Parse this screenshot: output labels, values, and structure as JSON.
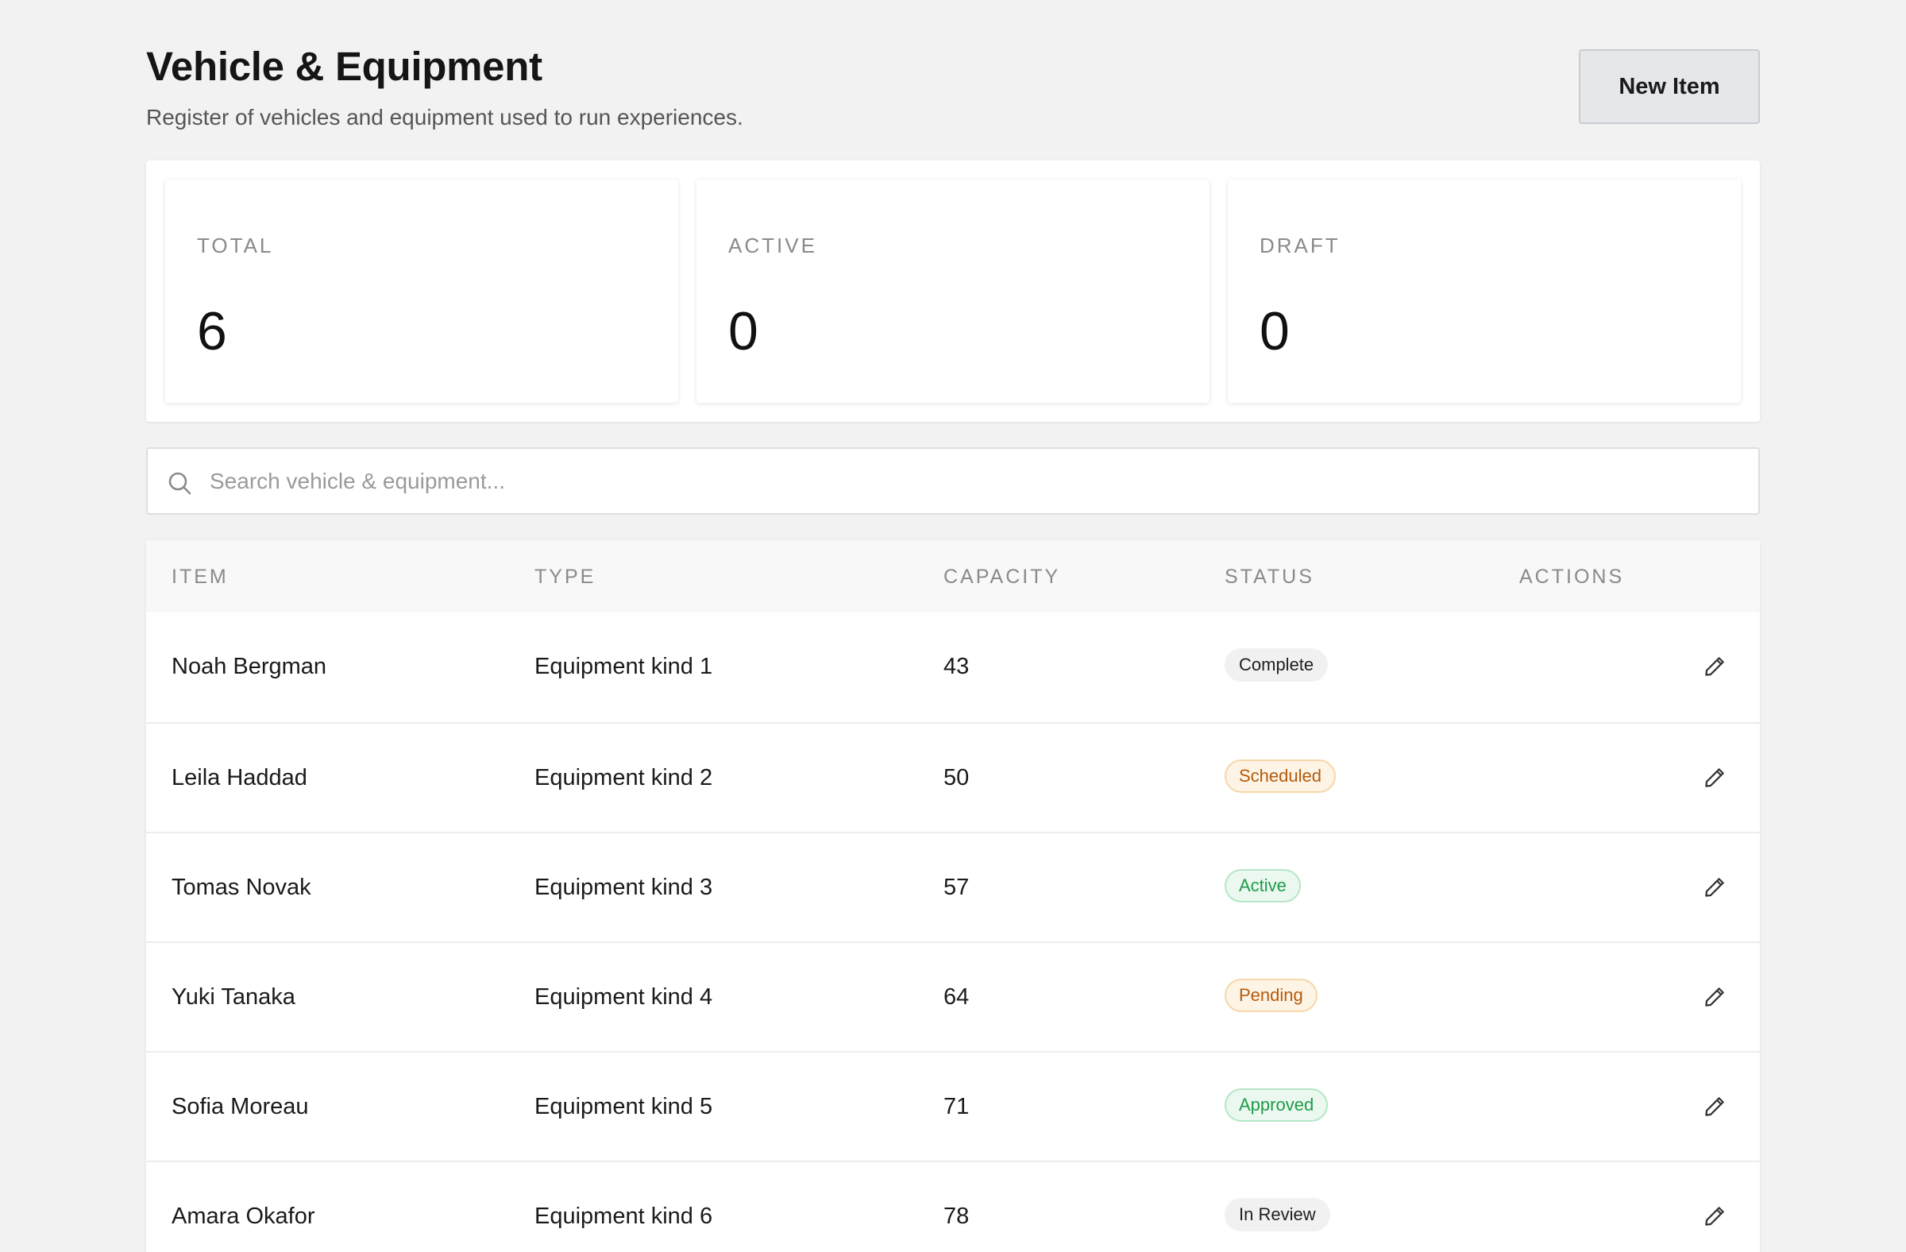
{
  "header": {
    "title": "Vehicle & Equipment",
    "subtitle": "Register of vehicles and equipment used to run experiences.",
    "new_button": "New Item"
  },
  "stats": [
    {
      "label": "TOTAL",
      "value": "6"
    },
    {
      "label": "ACTIVE",
      "value": "0"
    },
    {
      "label": "DRAFT",
      "value": "0"
    }
  ],
  "search": {
    "placeholder": "Search vehicle & equipment...",
    "value": "",
    "icon": "search-icon"
  },
  "table": {
    "columns": [
      "ITEM",
      "TYPE",
      "CAPACITY",
      "STATUS",
      "ACTIONS"
    ],
    "rows": [
      {
        "item": "Noah Bergman",
        "type": "Equipment kind 1",
        "capacity": "43",
        "status": "Complete",
        "status_tone": "neutral"
      },
      {
        "item": "Leila Haddad",
        "type": "Equipment kind 2",
        "capacity": "50",
        "status": "Scheduled",
        "status_tone": "orange"
      },
      {
        "item": "Tomas Novak",
        "type": "Equipment kind 3",
        "capacity": "57",
        "status": "Active",
        "status_tone": "green"
      },
      {
        "item": "Yuki Tanaka",
        "type": "Equipment kind 4",
        "capacity": "64",
        "status": "Pending",
        "status_tone": "orange"
      },
      {
        "item": "Sofia Moreau",
        "type": "Equipment kind 5",
        "capacity": "71",
        "status": "Approved",
        "status_tone": "green"
      },
      {
        "item": "Amara Okafor",
        "type": "Equipment kind 6",
        "capacity": "78",
        "status": "In Review",
        "status_tone": "neutral"
      }
    ],
    "action_icon": "pencil-icon"
  },
  "colors": {
    "background": "#f2f2f2",
    "badge_green": "#1f9a4a",
    "badge_orange": "#b45a0c"
  }
}
